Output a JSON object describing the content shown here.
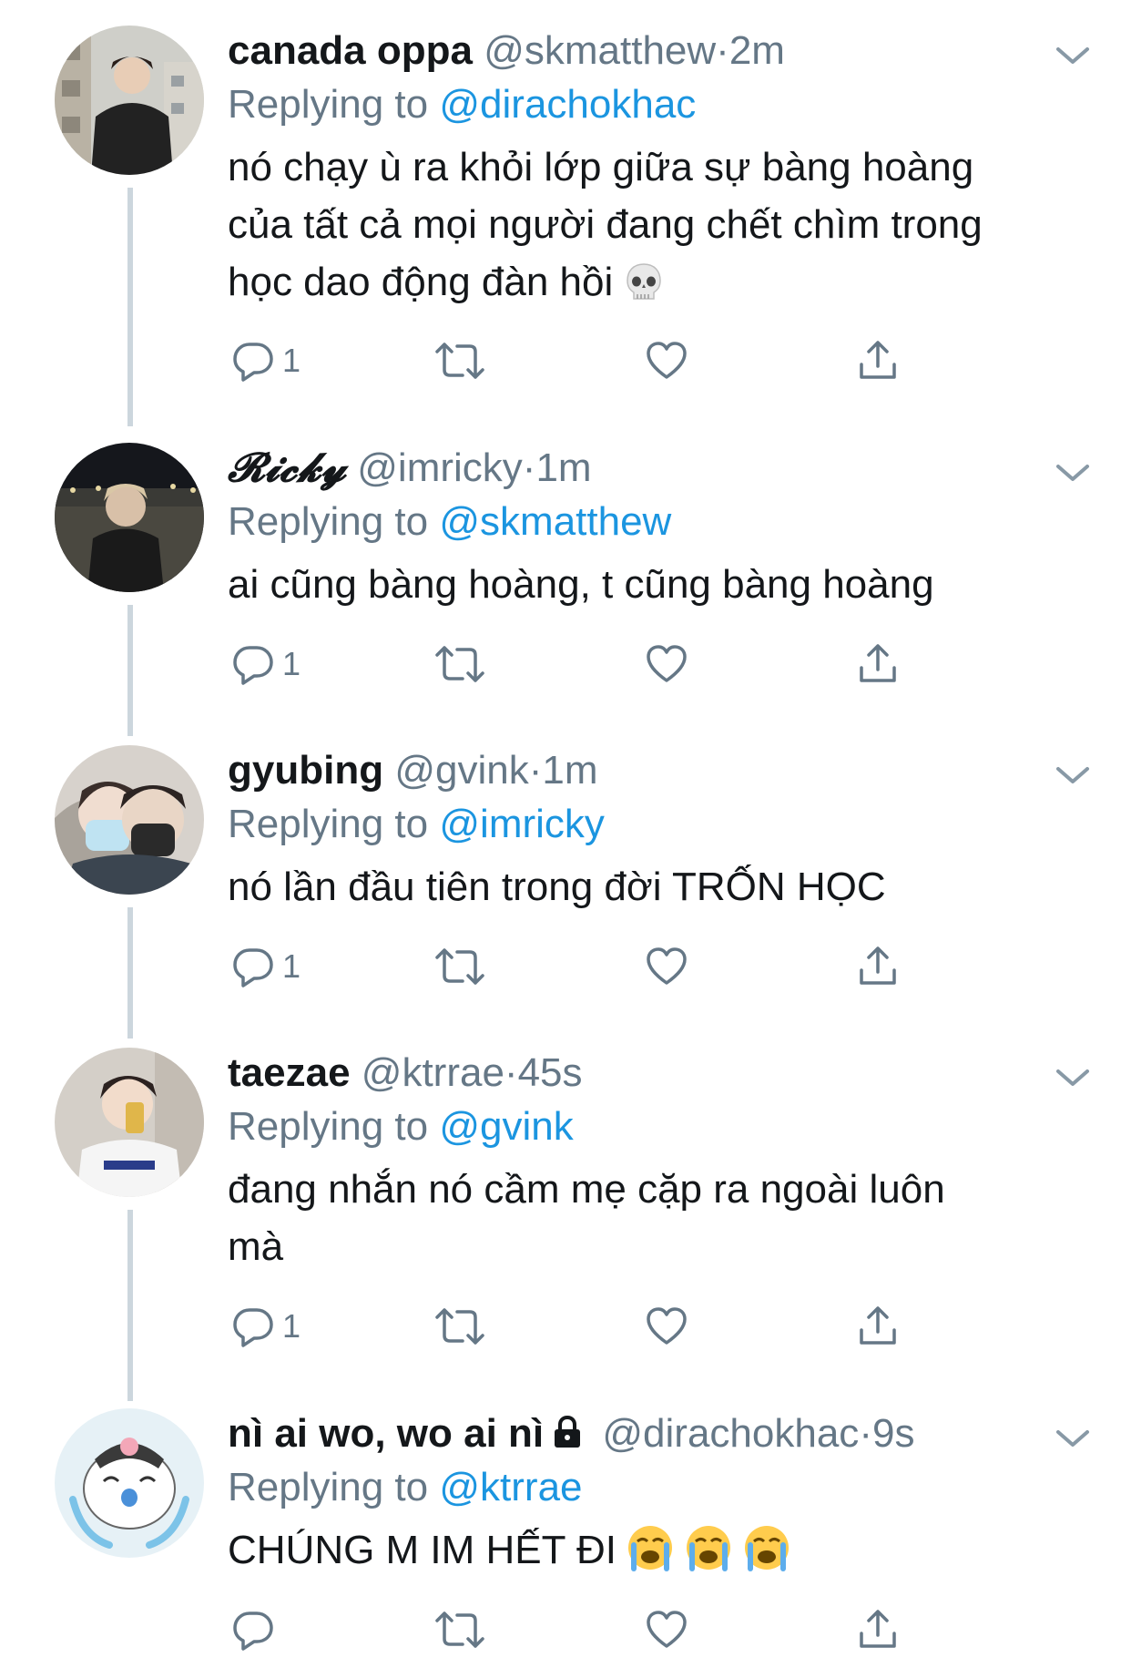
{
  "tweets": [
    {
      "name": "canada oppa",
      "handle": "@skmatthew",
      "dot": "·",
      "time": "2m",
      "replying_prefix": "Replying to",
      "replying_to": "@dirachokhac",
      "text_lines": [
        "nó chạy ù ra khỏi lớp giữa sự bàng hoàng",
        "của tất cả mọi người đang chết chìm trong",
        "học dao động đàn hồi"
      ],
      "emoji": [
        "skull-emoji"
      ],
      "reply_count": "1"
    },
    {
      "name": "𝓡𝓲𝓬𝓴𝔂",
      "handle": "@imricky",
      "dot": "·",
      "time": "1m",
      "replying_prefix": "Replying to",
      "replying_to": "@skmatthew",
      "text_lines": [
        "ai cũng bàng hoàng, t cũng bàng hoàng"
      ],
      "reply_count": "1"
    },
    {
      "name": "gyubing",
      "handle": "@gvink",
      "dot": "·",
      "time": "1m",
      "replying_prefix": "Replying to",
      "replying_to": "@imricky",
      "text_lines": [
        "nó lần đầu tiên trong đời TRỐN HỌC"
      ],
      "reply_count": "1"
    },
    {
      "name": "taezae",
      "handle": "@ktrrae",
      "dot": "·",
      "time": "45s",
      "replying_prefix": "Replying to",
      "replying_to": "@gvink",
      "text_lines": [
        "đang nhắn nó cầm mẹ cặp ra ngoài luôn",
        "mà"
      ],
      "reply_count": "1"
    },
    {
      "name": "nì ai wo, wo ai nì",
      "handle": "@dirachokhac",
      "dot": "·",
      "time": "9s",
      "replying_prefix": "Replying to",
      "replying_to": "@ktrrae",
      "text_lines": [
        "CHÚNG M IM HẾT ĐI"
      ],
      "emoji": [
        "loudly-crying-emoji",
        "loudly-crying-emoji",
        "loudly-crying-emoji"
      ],
      "reply_count": ""
    }
  ],
  "colors": {
    "text": "#14171a",
    "secondary": "#657786",
    "link": "#1b95e0",
    "thread_line": "#ccd6dd"
  },
  "icons": [
    "reply-icon",
    "retweet-icon",
    "like-icon",
    "share-icon",
    "caret-down-icon",
    "lock-icon"
  ]
}
